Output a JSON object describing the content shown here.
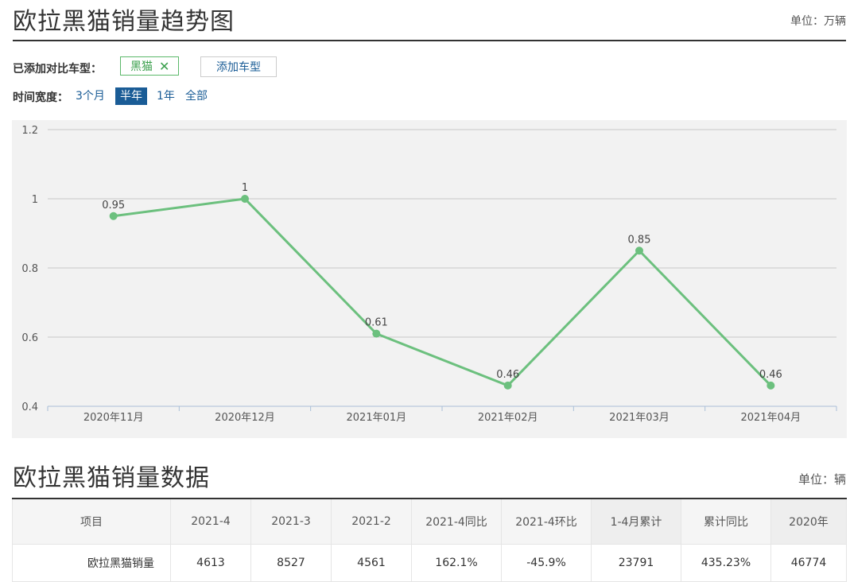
{
  "header": {
    "title": "欧拉黑猫销量趋势图",
    "unit": "单位：万辆"
  },
  "compare": {
    "label": "已添加对比车型：",
    "tag": "黑猫",
    "add_button": "添加车型"
  },
  "time_range": {
    "label": "时间宽度：",
    "options": [
      "3个月",
      "半年",
      "1年",
      "全部"
    ],
    "selected": "半年"
  },
  "chart_data": {
    "type": "line",
    "categories": [
      "2020年11月",
      "2020年12月",
      "2021年01月",
      "2021年02月",
      "2021年03月",
      "2021年04月"
    ],
    "series": [
      {
        "values": [
          0.95,
          1,
          0.61,
          0.46,
          0.85,
          0.46
        ]
      }
    ],
    "data_labels": [
      "0.95",
      "1",
      "0.61",
      "0.46",
      "0.85",
      "0.46"
    ],
    "y_ticks": [
      "0.4",
      "0.6",
      "0.8",
      "1",
      "1.2"
    ],
    "ylim": [
      0.4,
      1.2
    ],
    "grid": true,
    "line_color": "#6cc07e"
  },
  "table": {
    "title": "欧拉黑猫销量数据",
    "unit": "单位：辆",
    "headers": [
      "项目",
      "2021-4",
      "2021-3",
      "2021-2",
      "2021-4同比",
      "2021-4环比",
      "1-4月累计",
      "累计同比",
      "2020年"
    ],
    "rows": [
      [
        "欧拉黑猫销量",
        "4613",
        "8527",
        "4561",
        "162.1%",
        "-45.9%",
        "23791",
        "435.23%",
        "46774"
      ]
    ]
  }
}
